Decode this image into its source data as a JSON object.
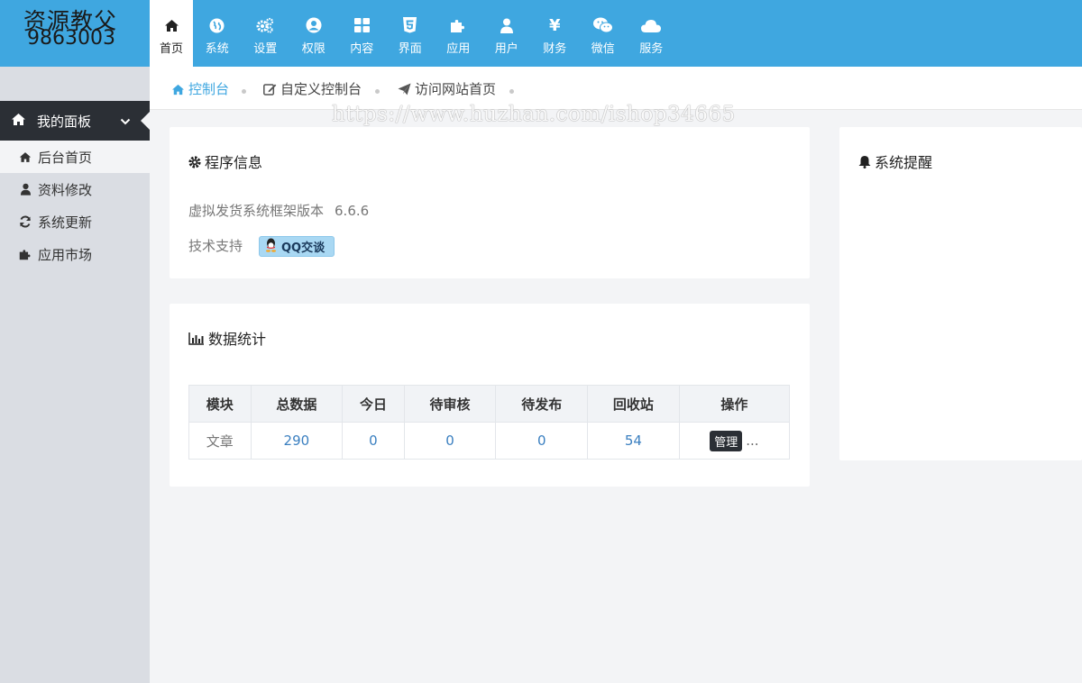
{
  "logo": {
    "line1": "资源教父",
    "line2": "9863003"
  },
  "nav": [
    {
      "label": "首页",
      "icon": "home-icon"
    },
    {
      "label": "系统",
      "icon": "globe-icon"
    },
    {
      "label": "设置",
      "icon": "cogs-icon"
    },
    {
      "label": "权限",
      "icon": "user-circle-icon"
    },
    {
      "label": "内容",
      "icon": "grid-icon"
    },
    {
      "label": "界面",
      "icon": "html5-icon"
    },
    {
      "label": "应用",
      "icon": "puzzle-icon"
    },
    {
      "label": "用户",
      "icon": "user-icon"
    },
    {
      "label": "财务",
      "icon": "yen-icon"
    },
    {
      "label": "微信",
      "icon": "wechat-icon"
    },
    {
      "label": "服务",
      "icon": "cloud-icon"
    }
  ],
  "sidebar": {
    "header": "我的面板",
    "items": [
      {
        "label": "后台首页",
        "icon": "home-icon"
      },
      {
        "label": "资料修改",
        "icon": "user-icon"
      },
      {
        "label": "系统更新",
        "icon": "refresh-icon"
      },
      {
        "label": "应用市场",
        "icon": "puzzle-icon"
      }
    ]
  },
  "breadcrumb": [
    {
      "label": "控制台",
      "icon": "home-icon"
    },
    {
      "label": "自定义控制台",
      "icon": "edit-icon"
    },
    {
      "label": "访问网站首页",
      "icon": "send-icon"
    }
  ],
  "watermark": "https://www.huzhan.com/ishop34665",
  "program_info": {
    "title": "程序信息",
    "version_label": "虚拟发货系统框架版本",
    "version_value": "6.6.6",
    "support_label": "技术支持",
    "qq_button": "QQ交谈"
  },
  "stats": {
    "title": "数据统计",
    "headers": [
      "模块",
      "总数据",
      "今日",
      "待审核",
      "待发布",
      "回收站",
      "操作"
    ],
    "rows": [
      {
        "module": "文章",
        "total": "290",
        "today": "0",
        "pending_review": "0",
        "pending_publish": "0",
        "recycle": "54",
        "action": "管理",
        "more": "..."
      }
    ]
  },
  "reminder": {
    "title": "系统提醒"
  },
  "colors": {
    "accent": "#3fa7e0",
    "dark": "#2b2f35"
  }
}
